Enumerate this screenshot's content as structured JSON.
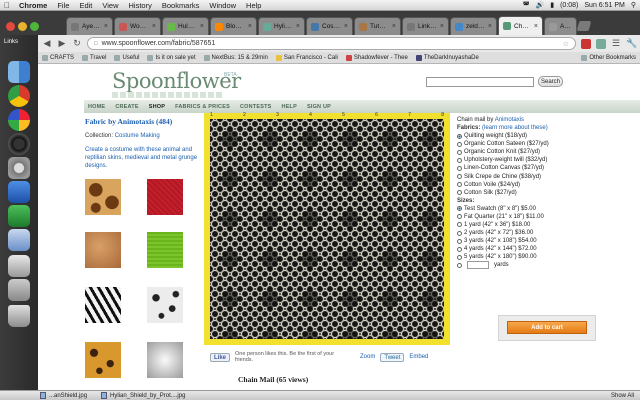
{
  "menubar": {
    "app": "Chrome",
    "items": [
      "File",
      "Edit",
      "View",
      "History",
      "Bookmarks",
      "Window",
      "Help"
    ],
    "battery": "(0:08)",
    "clock": "Sun 6:51 PM"
  },
  "tabs": [
    {
      "label": "Ayeletan",
      "active": false
    },
    {
      "label": "Women's",
      "active": false
    },
    {
      "label": "Hulu - Li",
      "active": false
    },
    {
      "label": "Blogger:",
      "active": false
    },
    {
      "label": "Hylian sh",
      "active": false
    },
    {
      "label": "Cosplay",
      "active": false
    },
    {
      "label": "Tutorial",
      "active": false
    },
    {
      "label": "Link Cost",
      "active": false
    },
    {
      "label": "zelda arr",
      "active": false
    },
    {
      "label": "Chain M",
      "active": true
    },
    {
      "label": "Apple -",
      "active": false
    }
  ],
  "toolbar": {
    "url": "www.spoonflower.com/fabric/587651"
  },
  "bookmarks": {
    "items": [
      "CRAFTS",
      "Travel",
      "Useful",
      "Is it on sale yet",
      "NextBus: 15 & 29min",
      "San Francisco - Cali",
      "Shadowfever - Thee",
      "TheDarkInuyashaDe"
    ],
    "other": "Other Bookmarks"
  },
  "dock": {
    "label": "Links"
  },
  "site": {
    "logo": "Spoonflower",
    "beta": "BETA",
    "search_button": "Search",
    "nav": [
      "HOME",
      "CREATE",
      "SHOP",
      "FABRICS & PRICES",
      "CONTESTS",
      "HELP",
      "SIGN UP"
    ]
  },
  "fabric": {
    "title": "Fabric by Animotaxis (484)",
    "collection_label": "Collection:",
    "collection": "Costume Making",
    "description": "Create a costume with these animal and reptilian skins, medieval and metal grunge designs."
  },
  "preview": {
    "ruler_numbers": [
      "1",
      "2",
      "3",
      "4",
      "5",
      "6",
      "7",
      "8"
    ],
    "like": "Like",
    "like_text": "One person likes this. Be the first of your friends.",
    "zoom": "Zoom",
    "tweet": "Tweet",
    "embed": "Embed",
    "chain_title": "Chain Mail (65 views)"
  },
  "order": {
    "title_prefix": "Chain mail by",
    "designer": "Animotaxis",
    "fabrics_label": "Fabrics:",
    "learn_more": "(learn more about these)",
    "fabrics": [
      {
        "label": "Quilting weight ($18/yd)",
        "selected": true
      },
      {
        "label": "Organic Cotton Sateen ($27/yd)",
        "selected": false
      },
      {
        "label": "Organic Cotton Knit ($27/yd)",
        "selected": false
      },
      {
        "label": "Upholstery-weight twill ($32/yd)",
        "selected": false
      },
      {
        "label": "Linen-Cotton Canvas ($27/yd)",
        "selected": false
      },
      {
        "label": "Silk Crepe de Chine ($38/yd)",
        "selected": false
      },
      {
        "label": "Cotton Voile ($24/yd)",
        "selected": false
      },
      {
        "label": "Cotton Silk ($27/yd)",
        "selected": false
      }
    ],
    "sizes_label": "Sizes:",
    "sizes": [
      {
        "label": "Test Swatch (8\" x 8\") $5.00",
        "selected": true
      },
      {
        "label": "Fat Quarter (21\" x 18\") $11.00",
        "selected": false
      },
      {
        "label": "1 yard (42\" x 36\") $18.00",
        "selected": false
      },
      {
        "label": "2 yards (42\" x 72\") $36.00",
        "selected": false
      },
      {
        "label": "3 yards (42\" x 108\") $54.00",
        "selected": false
      },
      {
        "label": "4 yards (42\" x 144\") $72.00",
        "selected": false
      },
      {
        "label": "5 yards (42\" x 180\") $90.00",
        "selected": false
      }
    ],
    "yards_suffix": "yards",
    "add_to_cart": "Add to cart"
  },
  "downloads": {
    "items": [
      "...anShield.jpg",
      "Hylian_Shield_by_Prot....jpg"
    ],
    "show_all": "Show All"
  },
  "colors": {
    "preview_border": "#f1e02e",
    "link": "#1b5fb0",
    "add_cart": "#e47b17"
  }
}
